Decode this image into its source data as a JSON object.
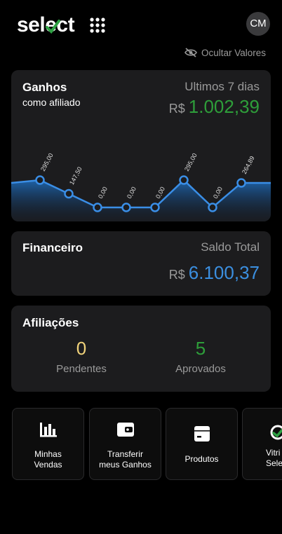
{
  "header": {
    "logo_text": "select",
    "avatar_initials": "CM",
    "hide_values_label": "Ocultar Valores"
  },
  "earnings_card": {
    "title": "Ganhos",
    "subtitle": "como afiliado",
    "period_label": "Ultimos 7 dias",
    "currency": "R$",
    "amount": "1.002,39",
    "amount_color": "#2e9e3a"
  },
  "chart_data": {
    "type": "area",
    "x": [
      1,
      2,
      3,
      4,
      5,
      6,
      7,
      8
    ],
    "values": [
      295.0,
      147.5,
      0.0,
      0.0,
      0.0,
      295.0,
      0.0,
      264.89
    ],
    "point_labels": [
      "295,00",
      "147,50",
      "0,00",
      "0,00",
      "0,00",
      "295,00",
      "0,00",
      "264,89"
    ],
    "ylim": [
      0,
      295
    ],
    "line_color": "#3a8ee6",
    "fill_color": "#1e5fa0",
    "grid": false
  },
  "finance_card": {
    "title": "Financeiro",
    "balance_label": "Saldo Total",
    "currency": "R$",
    "amount": "6.100,37",
    "amount_color": "#3b8fe0"
  },
  "affiliations_card": {
    "title": "Afiliações",
    "pending_count": "0",
    "pending_label": "Pendentes",
    "pending_color": "#f0d27a",
    "approved_count": "5",
    "approved_label": "Aprovados",
    "approved_color": "#2e9e3a"
  },
  "shortcuts": [
    {
      "label_line1": "Minhas",
      "label_line2": "Vendas",
      "icon": "bar-chart-icon"
    },
    {
      "label_line1": "Transferir",
      "label_line2": "meus Ganhos",
      "icon": "wallet-icon"
    },
    {
      "label_line1": "Produtos",
      "label_line2": "",
      "icon": "product-box-icon"
    },
    {
      "label_line1": "Vitri",
      "label_line2": "Sele",
      "icon": "select-logo-icon"
    }
  ]
}
